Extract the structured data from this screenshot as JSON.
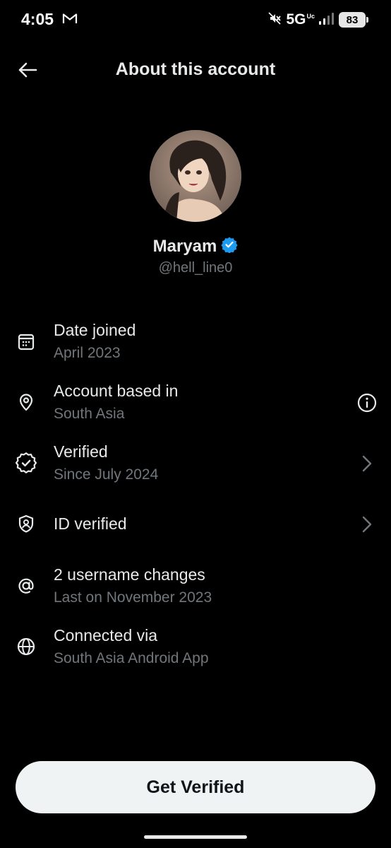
{
  "status_bar": {
    "time": "4:05",
    "network": "5G",
    "network_sub": "Uc",
    "battery": "83",
    "icons": [
      "gmail-icon",
      "mute-icon",
      "signal-icon",
      "battery-icon"
    ]
  },
  "header": {
    "title": "About this account",
    "back_icon": "arrow-left-icon"
  },
  "profile": {
    "name": "Maryam",
    "handle": "@hell_line0",
    "verified_badge_color": "#1d9bf0"
  },
  "info_items": [
    {
      "title": "Date joined",
      "subtitle": "April 2023",
      "icon": "calendar-icon"
    },
    {
      "title": "Account based in",
      "subtitle": "South Asia",
      "icon": "location-pin-icon",
      "action_icon": "info-icon"
    },
    {
      "title": "Verified",
      "subtitle": "Since July 2024",
      "icon": "verified-badge-icon",
      "action_icon": "chevron-right-icon"
    },
    {
      "title": "ID verified",
      "icon": "id-shield-icon",
      "action_icon": "chevron-right-icon"
    },
    {
      "title": "2 username changes",
      "subtitle": "Last on November 2023",
      "icon": "at-sign-icon"
    },
    {
      "title": "Connected via",
      "subtitle": "South Asia Android App",
      "icon": "globe-icon"
    }
  ],
  "footer": {
    "button_label": "Get Verified"
  },
  "colors": {
    "background": "#000000",
    "primary_text": "#e7e9ea",
    "secondary_text": "#71767b",
    "accent": "#1d9bf0",
    "button_bg": "#eff3f4"
  }
}
